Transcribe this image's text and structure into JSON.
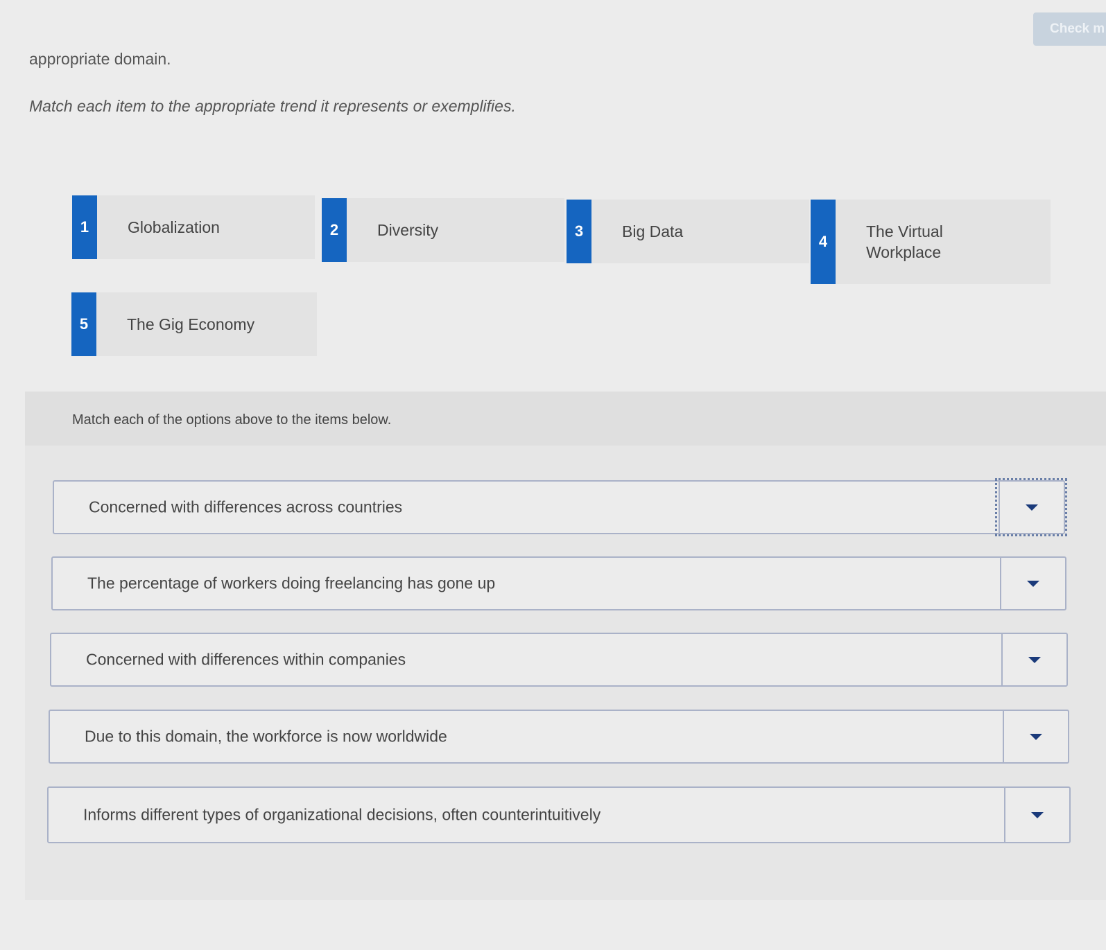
{
  "header": {
    "check_button_label": "Check m",
    "intro_text": "appropriate domain.",
    "instruction_text": "Match each item to the appropriate trend it represents or exemplifies."
  },
  "options": [
    {
      "number": "1",
      "label": "Globalization"
    },
    {
      "number": "2",
      "label": "Diversity"
    },
    {
      "number": "3",
      "label": "Big Data"
    },
    {
      "number": "4",
      "label": "The Virtual Workplace"
    },
    {
      "number": "5",
      "label": "The Gig Economy"
    }
  ],
  "match_panel": {
    "prompt": "Match each of the options above to the items below.",
    "items": [
      {
        "text": "Concerned with differences across countries"
      },
      {
        "text": "The percentage of workers doing freelancing has gone up"
      },
      {
        "text": "Concerned with differences within companies"
      },
      {
        "text": "Due to this domain, the workforce is now worldwide"
      },
      {
        "text": "Informs different types of organizational decisions, often counterintuitively"
      }
    ]
  },
  "icons": {
    "dropdown": "chevron-down-icon"
  },
  "colors": {
    "badge_blue": "#1565c0",
    "button_disabled": "#c8d3de",
    "row_border": "#aab2c8"
  }
}
